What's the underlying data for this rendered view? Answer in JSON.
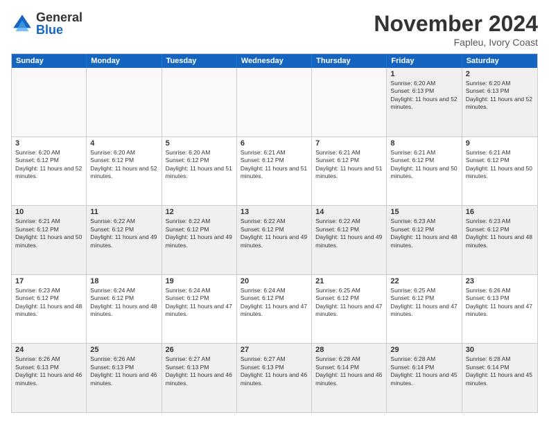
{
  "logo": {
    "general": "General",
    "blue": "Blue"
  },
  "header": {
    "month": "November 2024",
    "location": "Fapleu, Ivory Coast"
  },
  "days": [
    "Sunday",
    "Monday",
    "Tuesday",
    "Wednesday",
    "Thursday",
    "Friday",
    "Saturday"
  ],
  "weeks": [
    [
      {
        "day": "",
        "empty": true
      },
      {
        "day": "",
        "empty": true
      },
      {
        "day": "",
        "empty": true
      },
      {
        "day": "",
        "empty": true
      },
      {
        "day": "",
        "empty": true
      },
      {
        "day": "1",
        "sunrise": "Sunrise: 6:20 AM",
        "sunset": "Sunset: 6:13 PM",
        "daylight": "Daylight: 11 hours and 52 minutes."
      },
      {
        "day": "2",
        "sunrise": "Sunrise: 6:20 AM",
        "sunset": "Sunset: 6:13 PM",
        "daylight": "Daylight: 11 hours and 52 minutes."
      }
    ],
    [
      {
        "day": "3",
        "sunrise": "Sunrise: 6:20 AM",
        "sunset": "Sunset: 6:12 PM",
        "daylight": "Daylight: 11 hours and 52 minutes."
      },
      {
        "day": "4",
        "sunrise": "Sunrise: 6:20 AM",
        "sunset": "Sunset: 6:12 PM",
        "daylight": "Daylight: 11 hours and 52 minutes."
      },
      {
        "day": "5",
        "sunrise": "Sunrise: 6:20 AM",
        "sunset": "Sunset: 6:12 PM",
        "daylight": "Daylight: 11 hours and 51 minutes."
      },
      {
        "day": "6",
        "sunrise": "Sunrise: 6:21 AM",
        "sunset": "Sunset: 6:12 PM",
        "daylight": "Daylight: 11 hours and 51 minutes."
      },
      {
        "day": "7",
        "sunrise": "Sunrise: 6:21 AM",
        "sunset": "Sunset: 6:12 PM",
        "daylight": "Daylight: 11 hours and 51 minutes."
      },
      {
        "day": "8",
        "sunrise": "Sunrise: 6:21 AM",
        "sunset": "Sunset: 6:12 PM",
        "daylight": "Daylight: 11 hours and 50 minutes."
      },
      {
        "day": "9",
        "sunrise": "Sunrise: 6:21 AM",
        "sunset": "Sunset: 6:12 PM",
        "daylight": "Daylight: 11 hours and 50 minutes."
      }
    ],
    [
      {
        "day": "10",
        "sunrise": "Sunrise: 6:21 AM",
        "sunset": "Sunset: 6:12 PM",
        "daylight": "Daylight: 11 hours and 50 minutes."
      },
      {
        "day": "11",
        "sunrise": "Sunrise: 6:22 AM",
        "sunset": "Sunset: 6:12 PM",
        "daylight": "Daylight: 11 hours and 49 minutes."
      },
      {
        "day": "12",
        "sunrise": "Sunrise: 6:22 AM",
        "sunset": "Sunset: 6:12 PM",
        "daylight": "Daylight: 11 hours and 49 minutes."
      },
      {
        "day": "13",
        "sunrise": "Sunrise: 6:22 AM",
        "sunset": "Sunset: 6:12 PM",
        "daylight": "Daylight: 11 hours and 49 minutes."
      },
      {
        "day": "14",
        "sunrise": "Sunrise: 6:22 AM",
        "sunset": "Sunset: 6:12 PM",
        "daylight": "Daylight: 11 hours and 49 minutes."
      },
      {
        "day": "15",
        "sunrise": "Sunrise: 6:23 AM",
        "sunset": "Sunset: 6:12 PM",
        "daylight": "Daylight: 11 hours and 48 minutes."
      },
      {
        "day": "16",
        "sunrise": "Sunrise: 6:23 AM",
        "sunset": "Sunset: 6:12 PM",
        "daylight": "Daylight: 11 hours and 48 minutes."
      }
    ],
    [
      {
        "day": "17",
        "sunrise": "Sunrise: 6:23 AM",
        "sunset": "Sunset: 6:12 PM",
        "daylight": "Daylight: 11 hours and 48 minutes."
      },
      {
        "day": "18",
        "sunrise": "Sunrise: 6:24 AM",
        "sunset": "Sunset: 6:12 PM",
        "daylight": "Daylight: 11 hours and 48 minutes."
      },
      {
        "day": "19",
        "sunrise": "Sunrise: 6:24 AM",
        "sunset": "Sunset: 6:12 PM",
        "daylight": "Daylight: 11 hours and 47 minutes."
      },
      {
        "day": "20",
        "sunrise": "Sunrise: 6:24 AM",
        "sunset": "Sunset: 6:12 PM",
        "daylight": "Daylight: 11 hours and 47 minutes."
      },
      {
        "day": "21",
        "sunrise": "Sunrise: 6:25 AM",
        "sunset": "Sunset: 6:12 PM",
        "daylight": "Daylight: 11 hours and 47 minutes."
      },
      {
        "day": "22",
        "sunrise": "Sunrise: 6:25 AM",
        "sunset": "Sunset: 6:12 PM",
        "daylight": "Daylight: 11 hours and 47 minutes."
      },
      {
        "day": "23",
        "sunrise": "Sunrise: 6:26 AM",
        "sunset": "Sunset: 6:13 PM",
        "daylight": "Daylight: 11 hours and 47 minutes."
      }
    ],
    [
      {
        "day": "24",
        "sunrise": "Sunrise: 6:26 AM",
        "sunset": "Sunset: 6:13 PM",
        "daylight": "Daylight: 11 hours and 46 minutes."
      },
      {
        "day": "25",
        "sunrise": "Sunrise: 6:26 AM",
        "sunset": "Sunset: 6:13 PM",
        "daylight": "Daylight: 11 hours and 46 minutes."
      },
      {
        "day": "26",
        "sunrise": "Sunrise: 6:27 AM",
        "sunset": "Sunset: 6:13 PM",
        "daylight": "Daylight: 11 hours and 46 minutes."
      },
      {
        "day": "27",
        "sunrise": "Sunrise: 6:27 AM",
        "sunset": "Sunset: 6:13 PM",
        "daylight": "Daylight: 11 hours and 46 minutes."
      },
      {
        "day": "28",
        "sunrise": "Sunrise: 6:28 AM",
        "sunset": "Sunset: 6:14 PM",
        "daylight": "Daylight: 11 hours and 46 minutes."
      },
      {
        "day": "29",
        "sunrise": "Sunrise: 6:28 AM",
        "sunset": "Sunset: 6:14 PM",
        "daylight": "Daylight: 11 hours and 45 minutes."
      },
      {
        "day": "30",
        "sunrise": "Sunrise: 6:28 AM",
        "sunset": "Sunset: 6:14 PM",
        "daylight": "Daylight: 11 hours and 45 minutes."
      }
    ]
  ]
}
